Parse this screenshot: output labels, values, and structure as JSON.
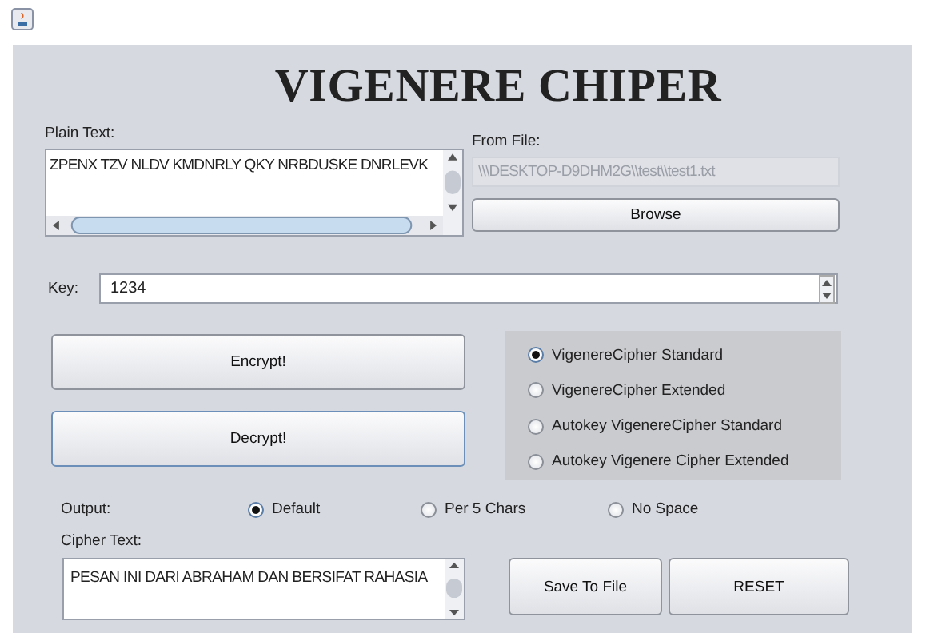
{
  "title": "VIGENERE CHIPER",
  "plain_text": {
    "label": "Plain Text:",
    "value": "ZPENX TZV NLDV KMDNRLY QKY NRBDUSKE DNRLEVK"
  },
  "from_file": {
    "label": "From File:",
    "value": "\\\\\\DESKTOP-D9DHM2G\\\\test\\\\test1.txt",
    "disabled": true,
    "button": "Browse"
  },
  "key": {
    "label": "Key:",
    "value": "1234"
  },
  "actions": [
    {
      "label": "Encrypt!",
      "focused": false
    },
    {
      "label": "Decrypt!",
      "focused": true
    }
  ],
  "modes": [
    {
      "label": "VigenereCipher Standard",
      "selected": true
    },
    {
      "label": "VigenereCipher Extended",
      "selected": false
    },
    {
      "label": "Autokey VigenereCipher Standard",
      "selected": false
    },
    {
      "label": "Autokey Vigenere Cipher Extended",
      "selected": false
    }
  ],
  "output": {
    "label": "Output:",
    "options": [
      {
        "label": "Default",
        "selected": true
      },
      {
        "label": "Per 5 Chars",
        "selected": false
      },
      {
        "label": "No Space",
        "selected": false
      }
    ]
  },
  "cipher_text": {
    "label": "Cipher Text:",
    "value": "PESAN INI DARI ABRAHAM DAN BERSIFAT RAHASIA"
  },
  "buttons": [
    "Save To File",
    "RESET"
  ]
}
